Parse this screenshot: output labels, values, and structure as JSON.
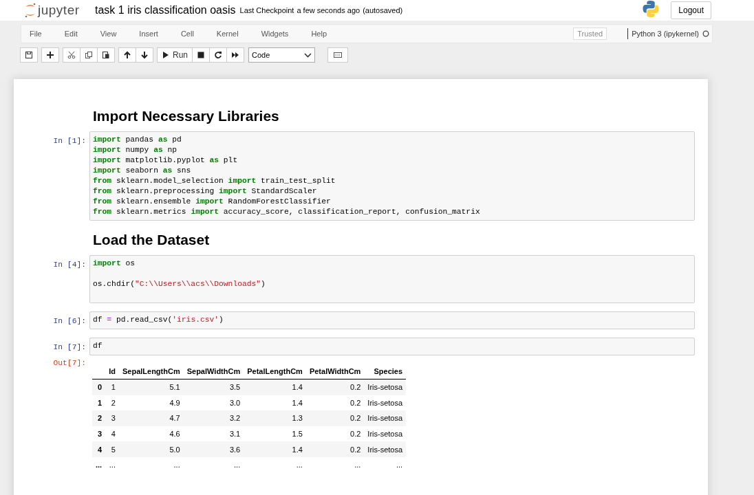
{
  "header": {
    "logo_text": "jupyter",
    "title": "task 1 iris classification oasis",
    "checkpoint_label": "Last Checkpoint",
    "checkpoint_time": "a few seconds ago",
    "save_status": "(autosaved)",
    "logout": "Logout"
  },
  "menubar": {
    "items": [
      "File",
      "Edit",
      "View",
      "Insert",
      "Cell",
      "Kernel",
      "Widgets",
      "Help"
    ],
    "trusted": "Trusted",
    "kernel": "Python 3 (ipykernel)"
  },
  "toolbar": {
    "run_label": "Run",
    "cell_type": "Code"
  },
  "cells": [
    {
      "kind": "markdown",
      "heading": "Import Necessary Libraries"
    },
    {
      "kind": "code",
      "prompt": "In [1]:",
      "lines": [
        {
          "kind": "code",
          "tokens": [
            {
              "text": "import",
              "kind": "keyword"
            },
            {
              "text": " pandas ",
              "kind": "plain"
            },
            {
              "text": "as",
              "kind": "keyword"
            },
            {
              "text": " pd",
              "kind": "plain"
            }
          ]
        },
        {
          "kind": "code",
          "tokens": [
            {
              "text": "import",
              "kind": "keyword"
            },
            {
              "text": " numpy ",
              "kind": "plain"
            },
            {
              "text": "as",
              "kind": "keyword"
            },
            {
              "text": " np",
              "kind": "plain"
            }
          ]
        },
        {
          "kind": "code",
          "tokens": [
            {
              "text": "import",
              "kind": "keyword"
            },
            {
              "text": " matplotlib.pyplot ",
              "kind": "plain"
            },
            {
              "text": "as",
              "kind": "keyword"
            },
            {
              "text": " plt",
              "kind": "plain"
            }
          ]
        },
        {
          "kind": "code",
          "tokens": [
            {
              "text": "import",
              "kind": "keyword"
            },
            {
              "text": " seaborn ",
              "kind": "plain"
            },
            {
              "text": "as",
              "kind": "keyword"
            },
            {
              "text": " sns",
              "kind": "plain"
            }
          ]
        },
        {
          "kind": "code",
          "tokens": [
            {
              "text": "from",
              "kind": "keyword"
            },
            {
              "text": " sklearn.model_selection ",
              "kind": "plain"
            },
            {
              "text": "import",
              "kind": "keyword"
            },
            {
              "text": " train_test_split",
              "kind": "plain"
            }
          ]
        },
        {
          "kind": "code",
          "tokens": [
            {
              "text": "from",
              "kind": "keyword"
            },
            {
              "text": " sklearn.preprocessing ",
              "kind": "plain"
            },
            {
              "text": "import",
              "kind": "keyword"
            },
            {
              "text": " StandardScaler",
              "kind": "plain"
            }
          ]
        },
        {
          "kind": "code",
          "tokens": [
            {
              "text": "from",
              "kind": "keyword"
            },
            {
              "text": " sklearn.ensemble ",
              "kind": "plain"
            },
            {
              "text": "import",
              "kind": "keyword"
            },
            {
              "text": " RandomForestClassifier",
              "kind": "plain"
            }
          ]
        },
        {
          "kind": "code",
          "tokens": [
            {
              "text": "from",
              "kind": "keyword"
            },
            {
              "text": " sklearn.metrics ",
              "kind": "plain"
            },
            {
              "text": "import",
              "kind": "keyword"
            },
            {
              "text": " accuracy_score, classification_report, confusion_matrix",
              "kind": "plain"
            }
          ]
        }
      ]
    },
    {
      "kind": "markdown",
      "heading": "Load the Dataset"
    },
    {
      "kind": "code",
      "prompt": "In [4]:",
      "lines": [
        {
          "kind": "code",
          "tokens": [
            {
              "text": "import",
              "kind": "keyword"
            },
            {
              "text": " os",
              "kind": "plain"
            }
          ]
        },
        {
          "kind": "blank"
        },
        {
          "kind": "code",
          "tokens": [
            {
              "text": "os.chdir(",
              "kind": "plain"
            },
            {
              "text": "\"C:\\\\Users\\\\acs\\\\Downloads\"",
              "kind": "string"
            },
            {
              "text": ")",
              "kind": "plain"
            }
          ]
        },
        {
          "kind": "blank"
        }
      ]
    },
    {
      "kind": "code",
      "prompt": "In [6]:",
      "lines": [
        {
          "kind": "code",
          "tokens": [
            {
              "text": "df ",
              "kind": "plain"
            },
            {
              "text": "=",
              "kind": "operator"
            },
            {
              "text": " pd.read_csv(",
              "kind": "plain"
            },
            {
              "text": "'iris.csv'",
              "kind": "string"
            },
            {
              "text": ")",
              "kind": "plain"
            }
          ]
        }
      ]
    },
    {
      "kind": "code",
      "prompt": "In [7]:",
      "lines": [
        {
          "kind": "code",
          "tokens": [
            {
              "text": "df",
              "kind": "plain"
            }
          ]
        }
      ],
      "output": {
        "prompt": "Out[7]:",
        "columns": [
          "",
          "Id",
          "SepalLengthCm",
          "SepalWidthCm",
          "PetalLengthCm",
          "PetalWidthCm",
          "Species"
        ],
        "rows": [
          [
            "0",
            "1",
            "5.1",
            "3.5",
            "1.4",
            "0.2",
            "Iris-setosa"
          ],
          [
            "1",
            "2",
            "4.9",
            "3.0",
            "1.4",
            "0.2",
            "Iris-setosa"
          ],
          [
            "2",
            "3",
            "4.7",
            "3.2",
            "1.3",
            "0.2",
            "Iris-setosa"
          ],
          [
            "3",
            "4",
            "4.6",
            "3.1",
            "1.5",
            "0.2",
            "Iris-setosa"
          ],
          [
            "4",
            "5",
            "5.0",
            "3.6",
            "1.4",
            "0.2",
            "Iris-setosa"
          ],
          [
            "...",
            "...",
            "...",
            "...",
            "...",
            "...",
            "..."
          ]
        ]
      }
    }
  ]
}
